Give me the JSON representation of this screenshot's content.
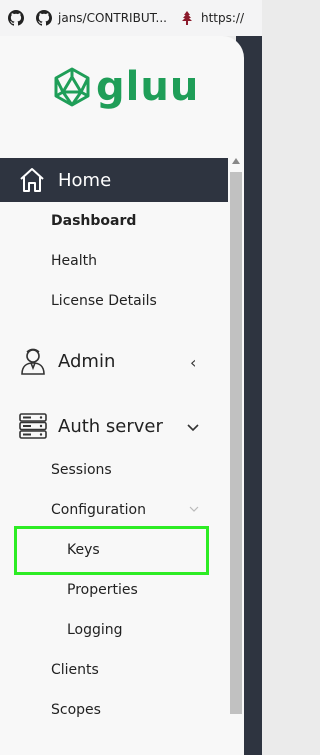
{
  "bookmarks": [
    {
      "icon": "github-icon",
      "label": ""
    },
    {
      "icon": "github-icon",
      "label": "jans/CONTRIBUT..."
    },
    {
      "icon": "tree-icon",
      "label": "https://"
    }
  ],
  "brand": {
    "name": "gluu",
    "color": "#1f9e58"
  },
  "nav": {
    "home": "Home",
    "home_items": [
      "Dashboard",
      "Health",
      "License Details"
    ],
    "admin": "Admin",
    "auth_server": "Auth server",
    "auth_items": {
      "sessions": "Sessions",
      "configuration": "Configuration",
      "config_items": [
        "Keys",
        "Properties",
        "Logging"
      ],
      "clients": "Clients",
      "scopes": "Scopes"
    }
  },
  "colors": {
    "header_bg": "#2e3440",
    "highlight": "#2dec24"
  }
}
